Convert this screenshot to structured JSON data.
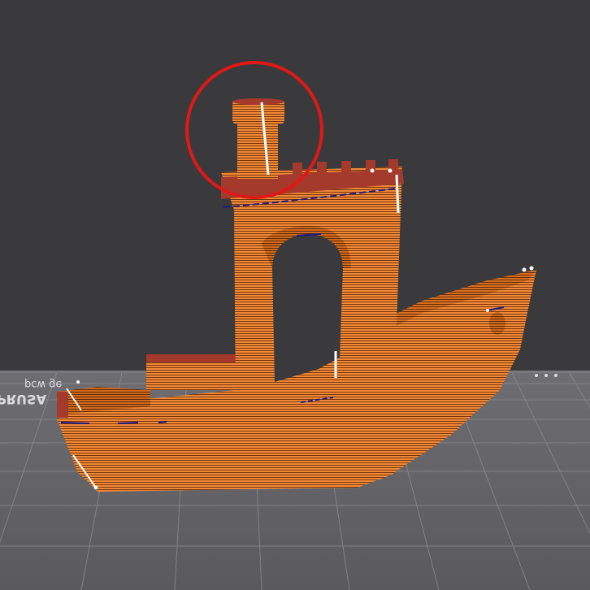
{
  "viewer": {
    "bed_label_main": "PRUSA",
    "bed_label_small": "pcw ge",
    "colors": {
      "background": "#3a3a3c",
      "bed": "#636366",
      "grid_line": "#8b8b8f",
      "model_light": "#f08a3a",
      "model_dark": "#b85a14",
      "layer_line": "#6b2d05",
      "top_surface": "#a33a2c",
      "highlight_circle": "#e01818",
      "seam_white": "#ffffff",
      "seam_blue": "#1a1a8a"
    },
    "model": {
      "name-icon": "benchy-boat-icon"
    }
  }
}
